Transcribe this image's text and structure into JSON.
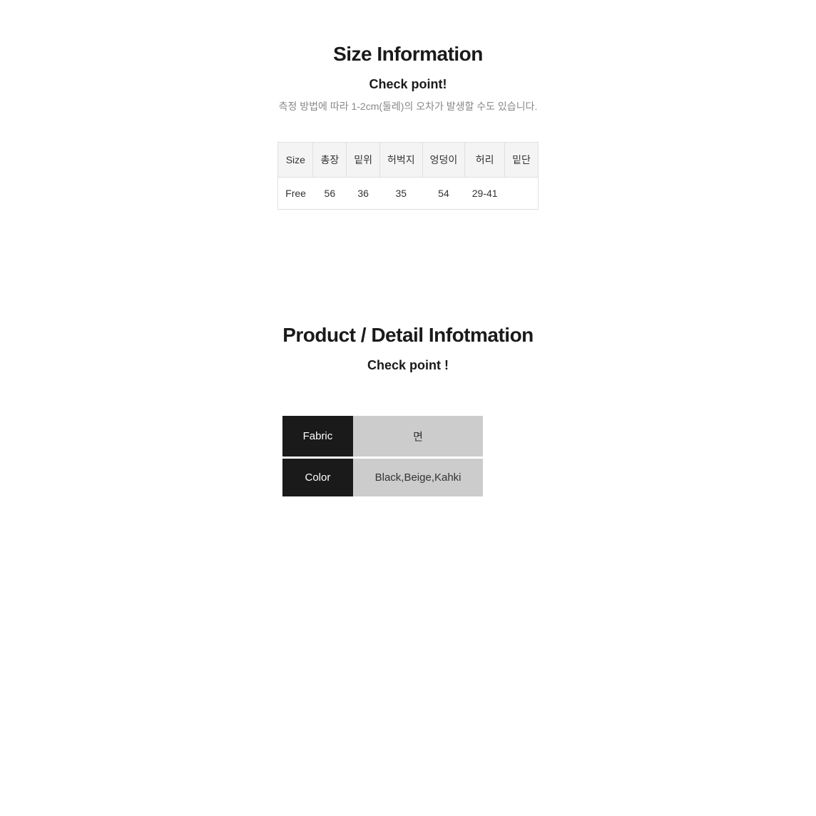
{
  "size_section": {
    "title": "Size Information",
    "check_point_title": "Check point!",
    "check_point_subtitle": "측정 방법에 따라 1-2cm(둘레)의 오차가 발생할 수도 있습니다.",
    "table": {
      "headers": [
        "Size",
        "총장",
        "밑위",
        "허벅지",
        "엉덩이",
        "허리",
        "밑단"
      ],
      "rows": [
        [
          "Free",
          "56",
          "36",
          "35",
          "54",
          "29-41",
          ""
        ]
      ]
    }
  },
  "detail_section": {
    "title": "Product / Detail Infotmation",
    "check_point_title": "Check point !",
    "rows": [
      {
        "label": "Fabric",
        "value": "면"
      },
      {
        "label": "Color",
        "value": "Black,Beige,Kahki"
      }
    ]
  }
}
